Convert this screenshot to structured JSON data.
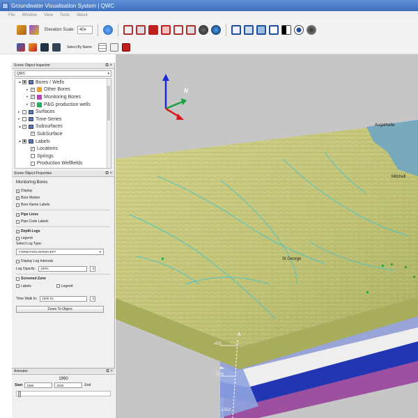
{
  "window": {
    "title": "Groundwater Visualisation System | QWC"
  },
  "menu": [
    "File",
    "Window",
    "View",
    "Tools",
    "About"
  ],
  "toolbar": {
    "elevation_label": "Elevation Scale:",
    "elevation_value": "40x"
  },
  "toolbar2": {
    "select_by_name": "Select By Name"
  },
  "inspector": {
    "title": "Scene Object Inspector",
    "combo_value": "QWC",
    "tree": [
      {
        "label": "Bores / Wells",
        "level": 0,
        "expand": "▲",
        "check": "■"
      },
      {
        "label": "Other Bores",
        "level": 1,
        "expand": "▸",
        "check": "✓",
        "color": "#f0a020"
      },
      {
        "label": "Monitoring Bores",
        "level": 1,
        "expand": "▸",
        "check": "✓",
        "color": "#c040c0"
      },
      {
        "label": "P&G production wells",
        "level": 1,
        "expand": "▸",
        "check": "✓",
        "color": "#20b060"
      },
      {
        "label": "Surfaces",
        "level": 0,
        "expand": "▸",
        "check": ""
      },
      {
        "label": "Time-Series",
        "level": 0,
        "expand": "▸",
        "check": ""
      },
      {
        "label": "Subsurfaces",
        "level": 0,
        "expand": "▲",
        "check": "✓"
      },
      {
        "label": "SubSurface",
        "level": 1,
        "expand": "",
        "check": "✓"
      },
      {
        "label": "Labels",
        "level": 0,
        "expand": "▲",
        "check": "■"
      },
      {
        "label": "Locations",
        "level": 1,
        "expand": "",
        "check": "✓"
      },
      {
        "label": "Springs",
        "level": 1,
        "expand": "",
        "check": ""
      },
      {
        "label": "Production Wellfields",
        "level": 1,
        "expand": "",
        "check": ""
      }
    ]
  },
  "properties": {
    "title": "Scene Object Properties",
    "heading": "Monitoring Bores",
    "display": "Display",
    "bore_marker": "Bore Marker",
    "bore_name_labels": "Bore Name Labels",
    "pipe_lines": "Pipe Lines",
    "pipe_code_labels": "Pipe Code Labels",
    "depth_logs": "Depth Logs",
    "legend": "Legend",
    "select_log_type": "Select Log Type:",
    "log_type_value": "FORMATION INTERCEPT",
    "display_log_intervals": "Display Log Intervals",
    "log_opacity_label": "Log Opacity:",
    "log_opacity_value": "100%",
    "screened_zone": "Screened Zone",
    "labels": "Labels",
    "legend2": "Legend",
    "time_walk_label": "Time Walk In:",
    "time_walk_value": "1000 Sx",
    "zoom_button": "Zoom To Object"
  },
  "animator": {
    "title": "Animator",
    "year": "1990",
    "start_label": "Start",
    "start_value": "1986",
    "end_value": "2030",
    "end_label": "End"
  },
  "viewport": {
    "labels": [
      "Augathella",
      "Mitchell",
      "St George"
    ],
    "depth_labels": [
      "-455",
      "-509",
      "-1553"
    ],
    "axis_label": "A",
    "north_label": "N",
    "colors": {
      "surface": "#c8c87a",
      "cliff": "#a8ad5c",
      "streams": "#46c4cc",
      "bg": "#c6c6c6"
    }
  }
}
